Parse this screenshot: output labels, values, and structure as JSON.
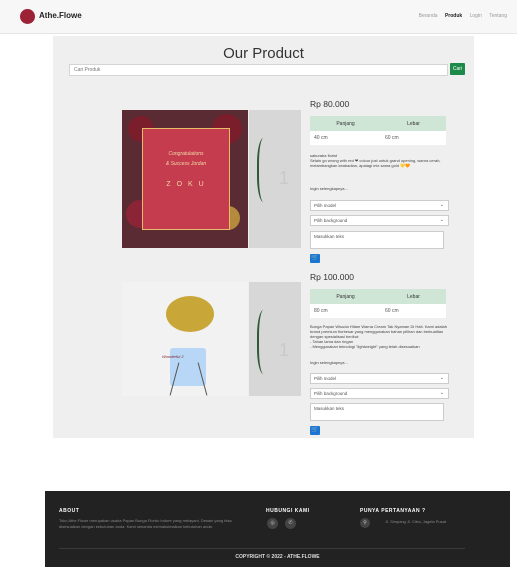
{
  "nav": {
    "brand": "Athe.Flowe",
    "links": [
      "Beranda",
      "Produk",
      "Login",
      "Tentang"
    ]
  },
  "page": {
    "title": "Our Product",
    "search_placeholder": "Cari Produk",
    "search_button": "Cari"
  },
  "products": [
    {
      "price": "Rp 80.000",
      "headers": [
        "Panjang",
        "Lebar"
      ],
      "panjang": "40 cm",
      "lebar": "60 cm",
      "desc": "sakuraba florist\nSelain go wrong with red ❤ colour just untuk grand opening, warna cerah, melambangkan keabadian, apalagi mix sama gold 💛🧡",
      "desc2": "Ingin selengkapnya...",
      "model_placeholder": "Pilih model",
      "bg_placeholder": "Pilih background",
      "text_placeholder": "Masukkan teks",
      "image_text": [
        "Congratulations",
        "& Success Jordan",
        "Z O K U"
      ],
      "side_number": "1"
    },
    {
      "price": "Rp 100.000",
      "headers": [
        "Panjang",
        "Lebar"
      ],
      "panjang": "80 cm",
      "lebar": "60 cm",
      "desc": "Bunga Papan Wisuda Hitam Warna Cream Tak Nyaman Di Hati. Kami adalah brand premium florbesar yang menggunakan bahan pilihan dan berkualitas dengan spesialisasi berikut:\n- Tahan lama dan ringan\n- Menggunakan teknologi \"lightweight\" yang telah disesuaikan",
      "desc2": "Ingin selengkapnya...",
      "model_placeholder": "Pilih model",
      "bg_placeholder": "Pilih background",
      "text_placeholder": "Masukkan teks",
      "image_text": [
        "Wonderful 2"
      ],
      "side_number": "1"
    }
  ],
  "footer": {
    "about_title": "ABOUT",
    "about_text": "Toko Athe.Flowe merupakan usaha Papan Bunga Florbu Indore yang melayani. Desain yang bisa disesuaikan dengan kebutuhan anda. Kami senantia memaksimalkan kebutuhan anda.",
    "contact_title": "HUBUNGI KAMI",
    "faq_title": "PUNYA PERTANYAAN ?",
    "address": "Jl. Simpang Jl. Citra, Jagela Pusat",
    "copyright": "COPYRIGHT © 2022 - ATHE.FLOWE"
  },
  "colors": {
    "brand": "#9b2335",
    "accent": "#1e8a4a",
    "cart": "#1976d2",
    "footer": "#222222"
  }
}
